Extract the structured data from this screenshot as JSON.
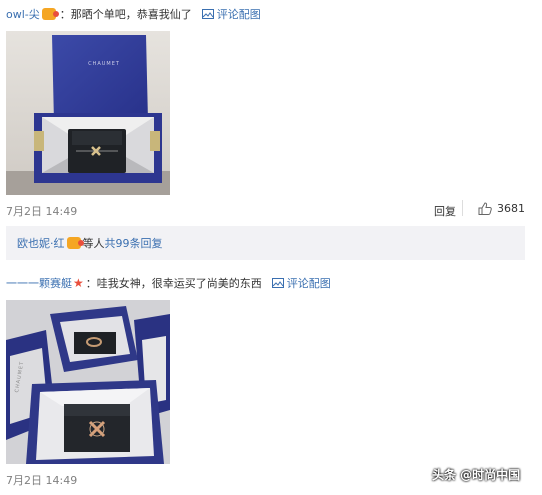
{
  "comment1": {
    "username": "owl-尖",
    "text": "：那晒个单吧，恭喜我仙了",
    "pic_link": "评论配图",
    "time": "7月2日 14:49",
    "reply": "回复",
    "likes": "3681",
    "photo_brand": "CHAUMET"
  },
  "reply_box": {
    "user": "欧也妮·红",
    "text": " 等人 ",
    "count": "共99条回复"
  },
  "comment2": {
    "username": "一一一颗赛艇",
    "text": "：哇我女神，很幸运买了尚美的东西",
    "pic_link": "评论配图",
    "time": "7月2日 14:49",
    "photo_brand": "CHAUMET"
  },
  "watermark": "头条 @时尚中国",
  "colors": {
    "accent": "#eb7350",
    "name_blue": "#3a6fb0"
  }
}
